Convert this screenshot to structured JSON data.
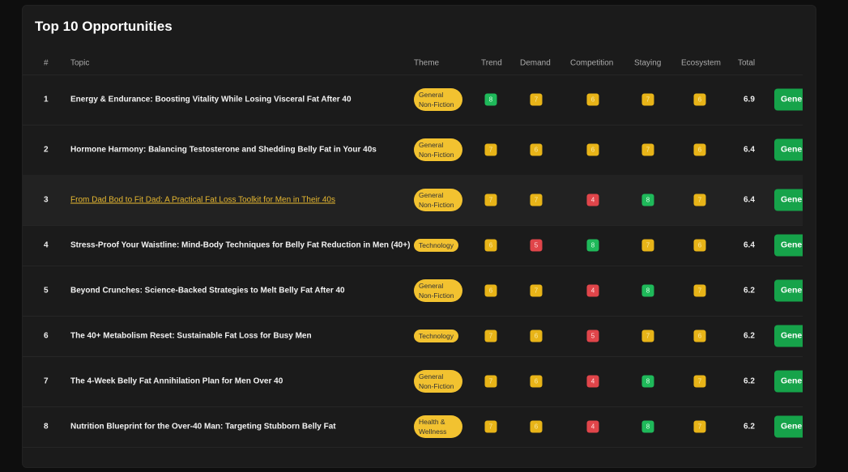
{
  "title": "Top 10 Opportunities",
  "headers": {
    "num": "#",
    "topic": "Topic",
    "theme": "Theme",
    "trend": "Trend",
    "demand": "Demand",
    "competition": "Competition",
    "staying": "Staying",
    "ecosystem": "Ecosystem",
    "total": "Total"
  },
  "button_label": "Generate",
  "colors": {
    "high": "#1fb95a",
    "mid": "#e8b418",
    "low": "#e0454a",
    "theme_pill": "#f2c230",
    "button": "#16a34a"
  },
  "rows": [
    {
      "num": "1",
      "topic": "Energy & Endurance: Boosting Vitality While Losing Visceral Fat After 40",
      "theme": "General Non-Fiction",
      "scores": [
        8,
        7,
        6,
        7,
        6
      ],
      "total": "6.9"
    },
    {
      "num": "2",
      "topic": "Hormone Harmony: Balancing Testosterone and Shedding Belly Fat in Your 40s",
      "theme": "General Non-Fiction",
      "scores": [
        7,
        6,
        6,
        7,
        6
      ],
      "total": "6.4"
    },
    {
      "num": "3",
      "topic": "From Dad Bod to Fit Dad: A Practical Fat Loss Toolkit for Men in Their 40s",
      "theme": "General Non-Fiction",
      "scores": [
        7,
        7,
        4,
        8,
        7
      ],
      "total": "6.4"
    },
    {
      "num": "4",
      "topic": "Stress-Proof Your Waistline: Mind-Body Techniques for Belly Fat Reduction in Men (40+)",
      "theme": "Technology",
      "scores": [
        6,
        5,
        8,
        7,
        6
      ],
      "total": "6.4"
    },
    {
      "num": "5",
      "topic": "Beyond Crunches: Science-Backed Strategies to Melt Belly Fat After 40",
      "theme": "General Non-Fiction",
      "scores": [
        6,
        7,
        4,
        8,
        7
      ],
      "total": "6.2"
    },
    {
      "num": "6",
      "topic": "The 40+ Metabolism Reset: Sustainable Fat Loss for Busy Men",
      "theme": "Technology",
      "scores": [
        7,
        6,
        5,
        7,
        6
      ],
      "total": "6.2"
    },
    {
      "num": "7",
      "topic": "The 4-Week Belly Fat Annihilation Plan for Men Over 40",
      "theme": "General Non-Fiction",
      "scores": [
        7,
        6,
        4,
        8,
        7
      ],
      "total": "6.2"
    },
    {
      "num": "8",
      "topic": "Nutrition Blueprint for the Over-40 Man: Targeting Stubborn Belly Fat",
      "theme": "Health & Wellness",
      "scores": [
        7,
        6,
        4,
        8,
        7
      ],
      "total": "6.2"
    }
  ]
}
